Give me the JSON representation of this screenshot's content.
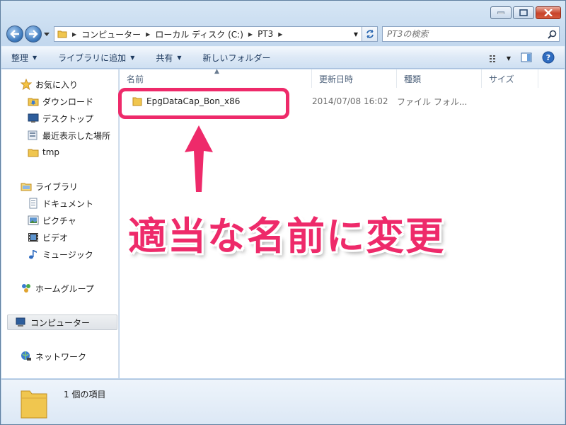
{
  "address": {
    "crumbs": [
      "コンピューター",
      "ローカル ディスク (C:)",
      "PT3"
    ]
  },
  "search": {
    "placeholder": "PT3の検索"
  },
  "toolbar": {
    "organize": "整理",
    "add_to_library": "ライブラリに追加",
    "share": "共有",
    "new_folder": "新しいフォルダー"
  },
  "sidebar": {
    "favorites": "お気に入り",
    "downloads": "ダウンロード",
    "desktop": "デスクトップ",
    "recent": "最近表示した場所",
    "tmp": "tmp",
    "libraries": "ライブラリ",
    "documents": "ドキュメント",
    "pictures": "ピクチャ",
    "videos": "ビデオ",
    "music": "ミュージック",
    "homegroup": "ホームグループ",
    "computer": "コンピューター",
    "network": "ネットワーク"
  },
  "columns": {
    "name": "名前",
    "date": "更新日時",
    "type": "種類",
    "size": "サイズ"
  },
  "files": [
    {
      "name": "EpgDataCap_Bon_x86",
      "date": "2014/07/08 16:02",
      "type": "ファイル フォル..."
    }
  ],
  "annotation": {
    "text": "適当な名前に変更",
    "color": "#ee2a6a"
  },
  "details": {
    "count": "1 個の項目"
  }
}
